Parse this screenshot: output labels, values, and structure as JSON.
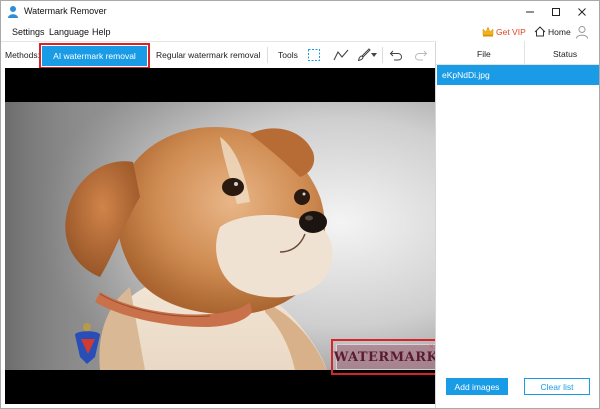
{
  "window": {
    "title": "Watermark Remover"
  },
  "menu": {
    "items": [
      "Settings",
      "Language",
      "Help"
    ],
    "vip_label": "Get VIP",
    "home_label": "Home"
  },
  "toolbar": {
    "methods_label": "Methods:",
    "ai_tab_label": "AI watermark removal",
    "regular_tab_label": "Regular watermark removal",
    "tools_label": "Tools"
  },
  "canvas": {
    "watermark_text": "WATERMARK",
    "watermark_close": "×"
  },
  "file_panel": {
    "columns": [
      "File",
      "Status"
    ],
    "files": [
      {
        "name": "eKpNdDi.jpg",
        "status": ""
      }
    ],
    "add_images_label": "Add images",
    "clear_list_label": "Clear list"
  },
  "icons": {
    "app": "app-person-icon",
    "vip": "crown-icon",
    "home": "home-icon",
    "user": "user-icon",
    "select": "rectangle-select-icon",
    "polyline": "polyline-icon",
    "brush": "brush-icon",
    "undo": "undo-icon",
    "redo": "redo-icon"
  },
  "colors": {
    "accent": "#1a9be6",
    "highlight": "#d9232a",
    "vip": "#e0451f"
  }
}
